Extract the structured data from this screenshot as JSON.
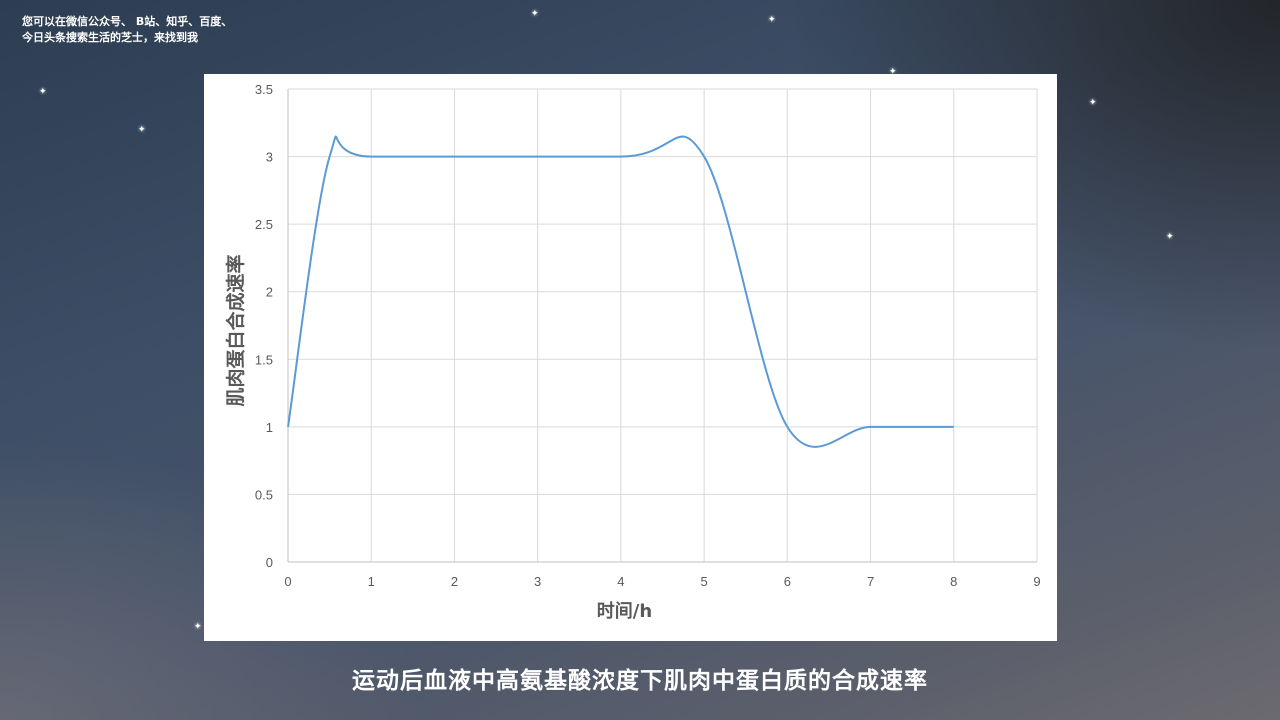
{
  "watermark": {
    "text": "您可以在微信公众号、 B站、知乎、百度、\n今日头条搜索生活的芝士，来找到我"
  },
  "caption": "运动后血液中高氨基酸浓度下肌肉中蛋白质的合成速率",
  "chart_data": {
    "type": "line",
    "title": "",
    "xlabel": "时间/h",
    "ylabel": "肌肉蛋白合成速率",
    "xlim": [
      0,
      9
    ],
    "ylim": [
      0,
      3.5
    ],
    "x_ticks": [
      "0",
      "1",
      "2",
      "3",
      "4",
      "5",
      "6",
      "7",
      "8",
      "9"
    ],
    "y_ticks": [
      "0",
      "0.5",
      "1",
      "1.5",
      "2",
      "2.5",
      "3",
      "3.5"
    ],
    "grid": true,
    "series": [
      {
        "color": "#5b9bd5",
        "smooth": true,
        "x": [
          0,
          0.5,
          1,
          4,
          5,
          6,
          7,
          8
        ],
        "y": [
          1,
          3,
          3,
          3,
          3,
          1,
          1,
          1
        ]
      }
    ]
  }
}
